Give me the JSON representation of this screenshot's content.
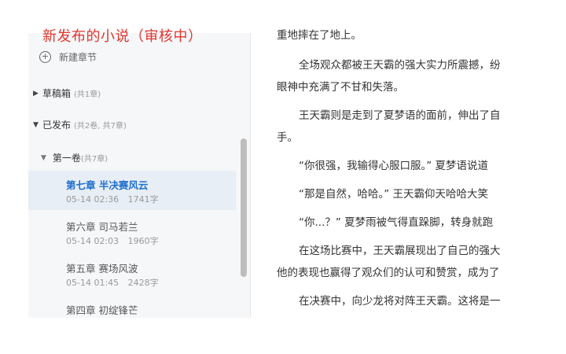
{
  "sidebar": {
    "new_chapter": "新建章节",
    "drafts": {
      "label": "草稿箱",
      "count": "(共1章)"
    },
    "published": {
      "label": "已发布",
      "count": "(共2卷, 共7章)"
    },
    "volume": {
      "label": "第一卷",
      "count": "(共7章)"
    },
    "chapters": [
      {
        "title": "第七章 半决赛风云",
        "date": "05-14 02:36",
        "words": "1741字",
        "active": true
      },
      {
        "title": "第六章 司马若兰",
        "date": "05-14 02:03",
        "words": "1960字"
      },
      {
        "title": "第五章 赛场风波",
        "date": "05-14 01:45",
        "words": "2428字"
      },
      {
        "title": "第四章 初绽锋芒",
        "date": "",
        "words": ""
      }
    ]
  },
  "overlay_note": "新发布的小说（审核中）",
  "content": {
    "lines": [
      "重地摔在了地上。",
      "全场观众都被王天霸的强大实力所震撼，纷",
      "眼神中充满了不甘和失落。",
      "王天霸则是走到了夏梦语的面前，伸出了自",
      "手。",
      "“你很强，我输得心服口服。” 夏梦语说道",
      "“那是自然，哈哈。” 王天霸仰天哈哈大笑",
      "“你...？” 夏梦雨被气得直跺脚，转身就跑",
      "在这场比赛中，王天霸展现出了自己的强大",
      "他的表现也赢得了观众们的认可和赞赏，成为了",
      "在决赛中，向少龙将对阵王天霸。这将是一"
    ]
  }
}
